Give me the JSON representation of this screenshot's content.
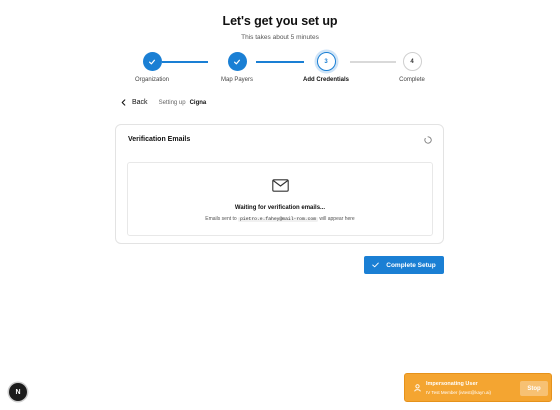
{
  "header": {
    "title": "Let's get you set up",
    "subtitle": "This takes about 5 minutes"
  },
  "colors": {
    "accent": "#1a7fd4",
    "toast": "#f4a531",
    "connector_done": "#1a7fd4",
    "connector_todo": "#d9d9d9"
  },
  "stepper": {
    "steps": [
      {
        "number": "",
        "label": "Organization",
        "state": "done",
        "icon": "check-icon"
      },
      {
        "number": "",
        "label": "Map Payers",
        "state": "done",
        "icon": "check-icon"
      },
      {
        "number": "3",
        "label": "Add Credentials",
        "state": "current"
      },
      {
        "number": "4",
        "label": "Complete",
        "state": "todo"
      }
    ]
  },
  "nav": {
    "back_label": "Back",
    "setting_up_label": "Setting up",
    "payer_name": "Cigna"
  },
  "card": {
    "title": "Verification Emails",
    "spinner_icon": "loading-spinner-icon",
    "empty_icon": "mail-icon",
    "waiting_text": "Waiting for verification emails...",
    "note_prefix": "Emails sent to",
    "email": "pietro.e.fahey@mail-rom.com",
    "note_suffix": "will appear here"
  },
  "actions": {
    "complete_label": "Complete Setup"
  },
  "corner_badge": {
    "letter": "N"
  },
  "toast": {
    "icon": "user-icon",
    "title": "Impersonating User",
    "subtitle": "IV Test Member (ivtest@kayn.ai)",
    "stop_label": "Stop"
  }
}
